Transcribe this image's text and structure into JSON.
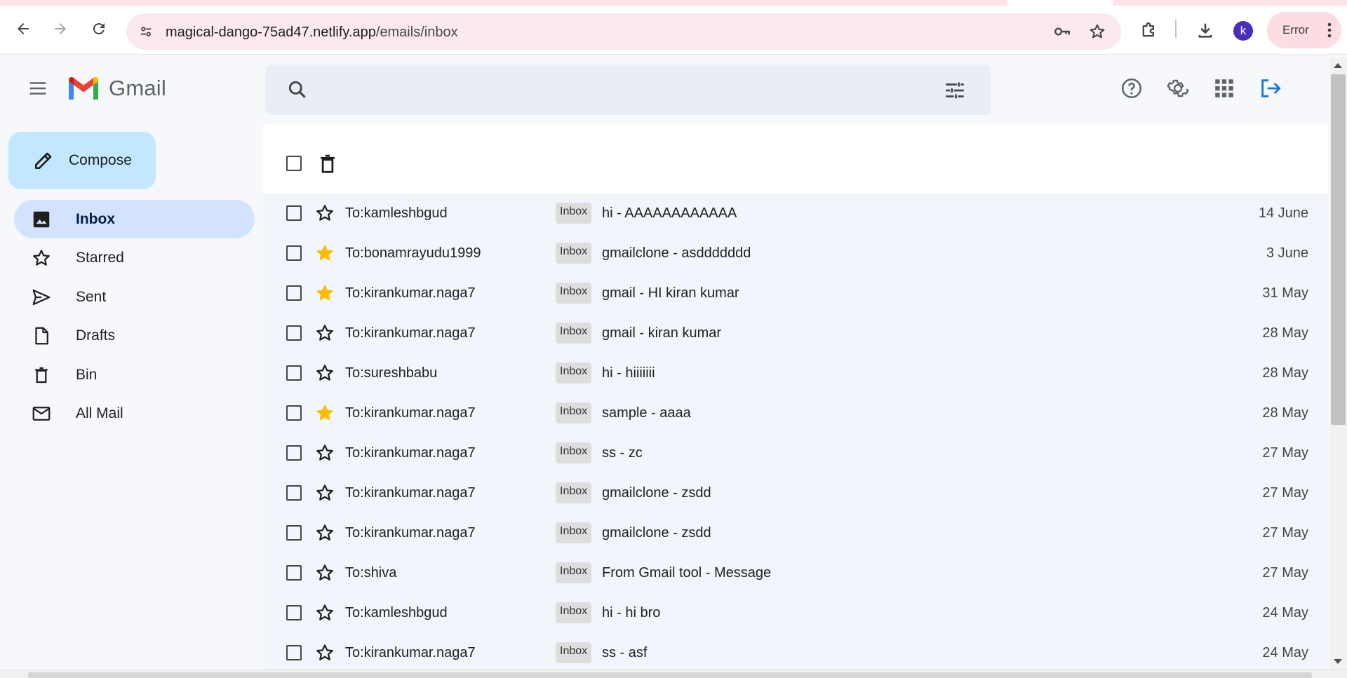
{
  "browser": {
    "url_host": "magical-dango-75ad47.netlify.app",
    "url_path": "/emails/inbox",
    "profile_initial": "k",
    "error_label": "Error"
  },
  "app": {
    "name": "Gmail",
    "search_placeholder": ""
  },
  "sidebar": {
    "compose_label": "Compose",
    "items": [
      {
        "label": "Inbox",
        "icon": "inbox-icon",
        "active": true
      },
      {
        "label": "Starred",
        "icon": "star-outline-icon",
        "active": false
      },
      {
        "label": "Sent",
        "icon": "send-icon",
        "active": false
      },
      {
        "label": "Drafts",
        "icon": "draft-icon",
        "active": false
      },
      {
        "label": "Bin",
        "icon": "trash-icon",
        "active": false
      },
      {
        "label": "All Mail",
        "icon": "mail-icon",
        "active": false
      }
    ]
  },
  "emails": [
    {
      "to": "To:kamleshbgud",
      "badge": "Inbox",
      "subject": "hi - AAAAAAAAAAAA",
      "date": "14 June",
      "starred": false
    },
    {
      "to": "To:bonamrayudu1999",
      "badge": "Inbox",
      "subject": "gmailclone - asddddddd",
      "date": "3 June",
      "starred": true
    },
    {
      "to": "To:kirankumar.naga7",
      "badge": "Inbox",
      "subject": "gmail - HI kiran kumar",
      "date": "31 May",
      "starred": true
    },
    {
      "to": "To:kirankumar.naga7",
      "badge": "Inbox",
      "subject": "gmail - kiran kumar",
      "date": "28 May",
      "starred": false
    },
    {
      "to": "To:sureshbabu",
      "badge": "Inbox",
      "subject": "hi - hiiiiiii",
      "date": "28 May",
      "starred": false
    },
    {
      "to": "To:kirankumar.naga7",
      "badge": "Inbox",
      "subject": "sample - aaaa",
      "date": "28 May",
      "starred": true
    },
    {
      "to": "To:kirankumar.naga7",
      "badge": "Inbox",
      "subject": "ss - zc",
      "date": "27 May",
      "starred": false
    },
    {
      "to": "To:kirankumar.naga7",
      "badge": "Inbox",
      "subject": "gmailclone - zsdd",
      "date": "27 May",
      "starred": false
    },
    {
      "to": "To:kirankumar.naga7",
      "badge": "Inbox",
      "subject": "gmailclone - zsdd",
      "date": "27 May",
      "starred": false
    },
    {
      "to": "To:shiva",
      "badge": "Inbox",
      "subject": "From Gmail tool - Message",
      "date": "27 May",
      "starred": false
    },
    {
      "to": "To:kamleshbgud",
      "badge": "Inbox",
      "subject": "hi - hi bro",
      "date": "24 May",
      "starred": false
    },
    {
      "to": "To:kirankumar.naga7",
      "badge": "Inbox",
      "subject": "ss - asf",
      "date": "24 May",
      "starred": false
    }
  ],
  "colors": {
    "star_filled": "#fbbc04",
    "compose_bg": "#c2e7ff",
    "active_nav_bg": "#d3e3fd",
    "logout_blue": "#1a73e8"
  }
}
